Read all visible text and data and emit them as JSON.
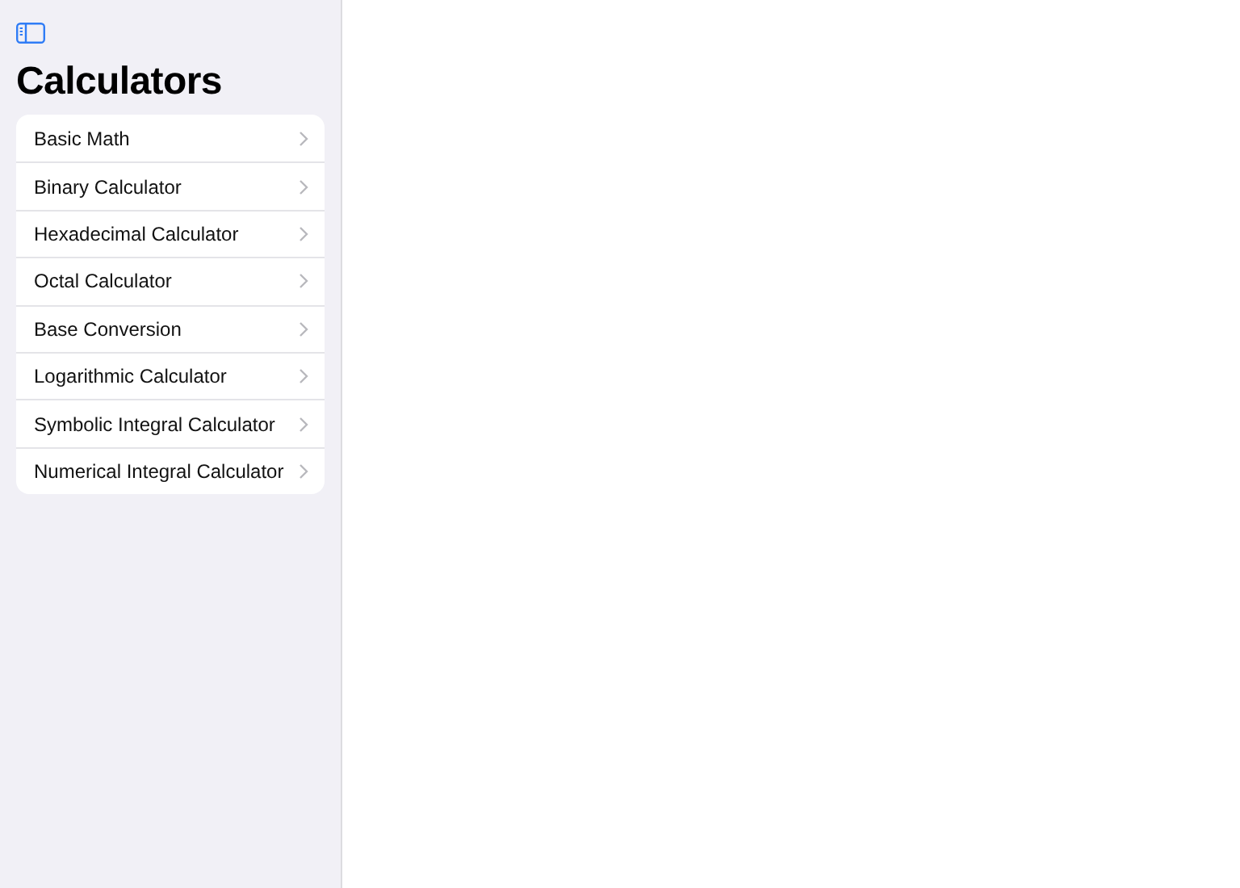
{
  "sidebar": {
    "title": "Calculators",
    "items": [
      {
        "label": "Basic Math"
      },
      {
        "label": "Binary Calculator"
      },
      {
        "label": "Hexadecimal Calculator"
      },
      {
        "label": "Octal Calculator"
      },
      {
        "label": "Base Conversion"
      },
      {
        "label": "Logarithmic Calculator"
      },
      {
        "label": "Symbolic Integral Calculator"
      },
      {
        "label": "Numerical Integral Calculator"
      }
    ]
  }
}
